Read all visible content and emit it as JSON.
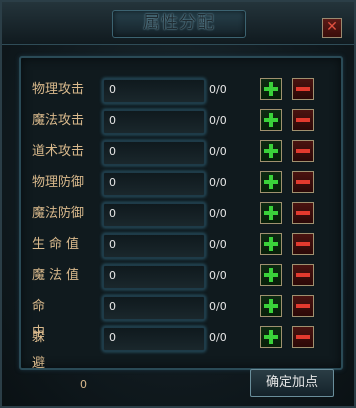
{
  "window": {
    "title": "属性分配",
    "close_icon": "close-icon"
  },
  "attributes": [
    {
      "label": "物理攻击",
      "value": "0",
      "ratio": "0/0"
    },
    {
      "label": "魔法攻击",
      "value": "0",
      "ratio": "0/0"
    },
    {
      "label": "道术攻击",
      "value": "0",
      "ratio": "0/0"
    },
    {
      "label": "物理防御",
      "value": "0",
      "ratio": "0/0"
    },
    {
      "label": "魔法防御",
      "value": "0",
      "ratio": "0/0"
    },
    {
      "label": "生命值",
      "value": "0",
      "ratio": "0/0"
    },
    {
      "label": "魔法值",
      "value": "0",
      "ratio": "0/0"
    },
    {
      "label": "命中",
      "value": "0",
      "ratio": "0/0"
    },
    {
      "label": "躲避",
      "value": "0",
      "ratio": "0/0"
    }
  ],
  "footer": {
    "available_points": "0",
    "confirm_label": "确定加点"
  },
  "colors": {
    "label": "#d9b98c",
    "plus": "#3ad23a",
    "minus": "#e33a2e"
  }
}
